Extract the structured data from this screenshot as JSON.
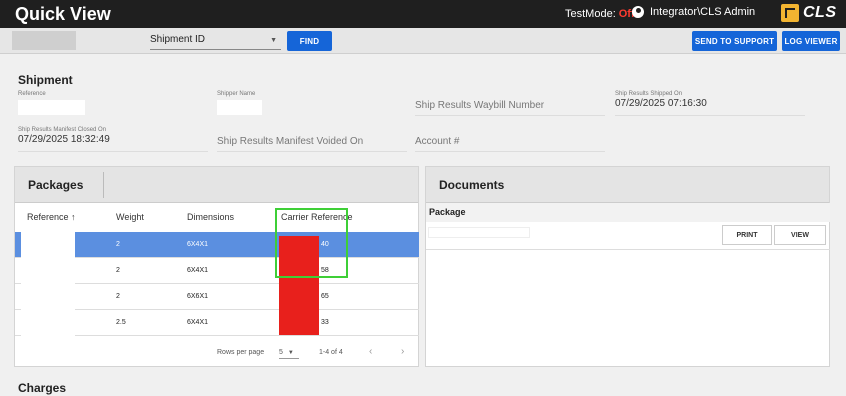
{
  "header": {
    "title": "Quick View",
    "testmode_label": "TestMode:",
    "testmode_value": "Off",
    "user": "Integrator\\CLS Admin",
    "logo_text": "CLS"
  },
  "search": {
    "field_value": "",
    "type_select": "Shipment ID",
    "find_label": "FIND"
  },
  "actions": {
    "send_to_support": "SEND TO SUPPORT",
    "log_viewer": "LOG VIEWER"
  },
  "shipment": {
    "title": "Shipment",
    "reference_label": "Reference",
    "shipper_name_label": "Shipper Name",
    "waybill_label": "Ship Results Waybill Number",
    "shipped_on_label": "Ship Results Shipped On",
    "shipped_on_value": "07/29/2025 07:16:30",
    "manifest_closed_label": "Ship Results Manifest Closed On",
    "manifest_closed_value": "07/29/2025 18:32:49",
    "manifest_voided_label": "Ship Results Manifest Voided On",
    "account_label": "Account #"
  },
  "packages": {
    "title": "Packages",
    "columns": [
      "Reference ↑",
      "Weight",
      "Dimensions",
      "Carrier Reference"
    ],
    "rows": [
      {
        "weight": "2",
        "dims": "6X4X1",
        "carrier_suffix": "40"
      },
      {
        "weight": "2",
        "dims": "6X4X1",
        "carrier_suffix": "58"
      },
      {
        "weight": "2",
        "dims": "6X6X1",
        "carrier_suffix": "65"
      },
      {
        "weight": "2.5",
        "dims": "6X4X1",
        "carrier_suffix": "33"
      }
    ],
    "rows_per_page_label": "Rows per page",
    "rows_per_page": "5",
    "range": "1-4 of 4",
    "prev": "‹",
    "next": "›"
  },
  "documents": {
    "title": "Documents",
    "sub_header": "Package",
    "print_label": "PRINT",
    "view_label": "VIEW"
  },
  "charges": {
    "title": "Charges"
  },
  "colors": {
    "accent": "#1565d8",
    "selected_row": "#5b8fe0",
    "highlight": "#3ecf36",
    "redaction": "#e8201c"
  }
}
